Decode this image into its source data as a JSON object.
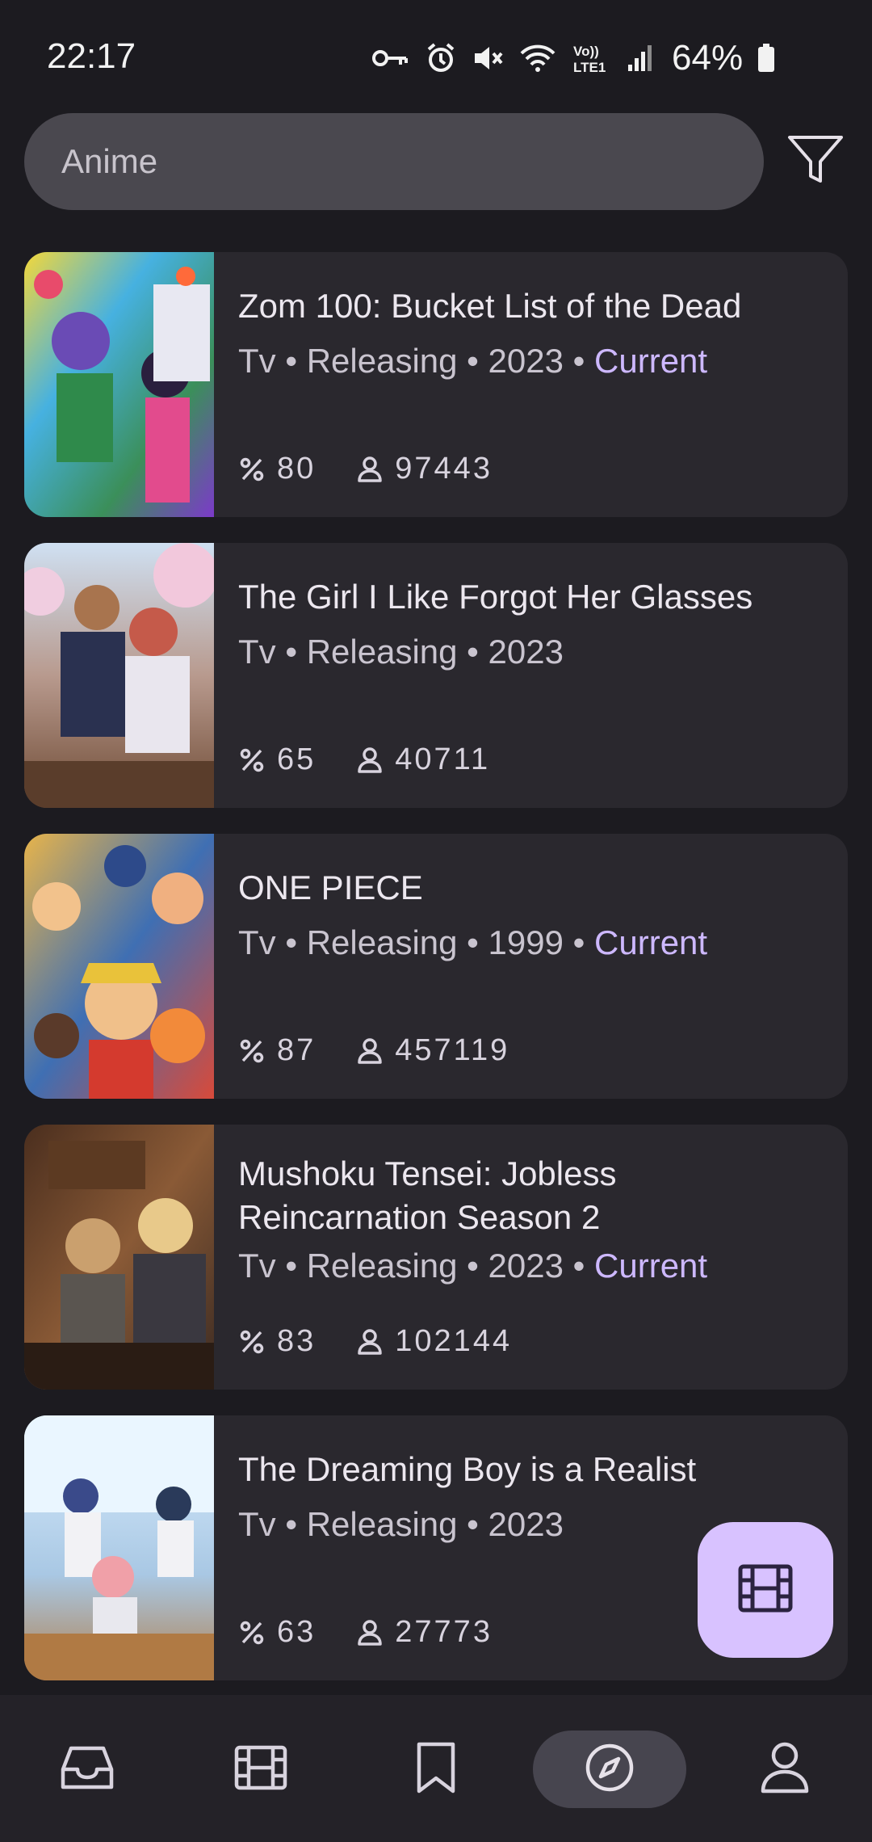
{
  "status_bar": {
    "time": "22:17",
    "battery": "64%",
    "network_label": "Vo)) LTE1",
    "icons": [
      "vpn-key-icon",
      "alarm-icon",
      "mute-icon",
      "wifi-icon",
      "volte-icon",
      "signal-icon",
      "battery-icon"
    ]
  },
  "search": {
    "value": "Anime",
    "filter_icon": "filter-icon"
  },
  "colors": {
    "background": "#1c1b20",
    "card": "#2a282e",
    "accent": "#cdb8ff",
    "fab": "#d8c2ff"
  },
  "items": [
    {
      "title": "Zom 100: Bucket List of the Dead",
      "format": "Tv",
      "status": "Releasing",
      "year": "2023",
      "list_status": "Current",
      "score": "80",
      "users": "97443"
    },
    {
      "title": "The Girl I Like Forgot Her Glasses",
      "format": "Tv",
      "status": "Releasing",
      "year": "2023",
      "list_status": "",
      "score": "65",
      "users": "40711"
    },
    {
      "title": "ONE PIECE",
      "format": "Tv",
      "status": "Releasing",
      "year": "1999",
      "list_status": "Current",
      "score": "87",
      "users": "457119"
    },
    {
      "title": "Mushoku Tensei: Jobless Reincarnation Season 2",
      "format": "Tv",
      "status": "Releasing",
      "year": "2023",
      "list_status": "Current",
      "score": "83",
      "users": "102144"
    },
    {
      "title": "The Dreaming Boy is a Realist",
      "format": "Tv",
      "status": "Releasing",
      "year": "2023",
      "list_status": "",
      "score": "63",
      "users": "27773"
    }
  ],
  "fab": {
    "icon": "film-icon"
  },
  "bottom_nav": [
    {
      "icon": "inbox-icon",
      "active": false
    },
    {
      "icon": "film-icon",
      "active": false
    },
    {
      "icon": "bookmark-icon",
      "active": false
    },
    {
      "icon": "compass-icon",
      "active": true
    },
    {
      "icon": "profile-icon",
      "active": false
    }
  ]
}
